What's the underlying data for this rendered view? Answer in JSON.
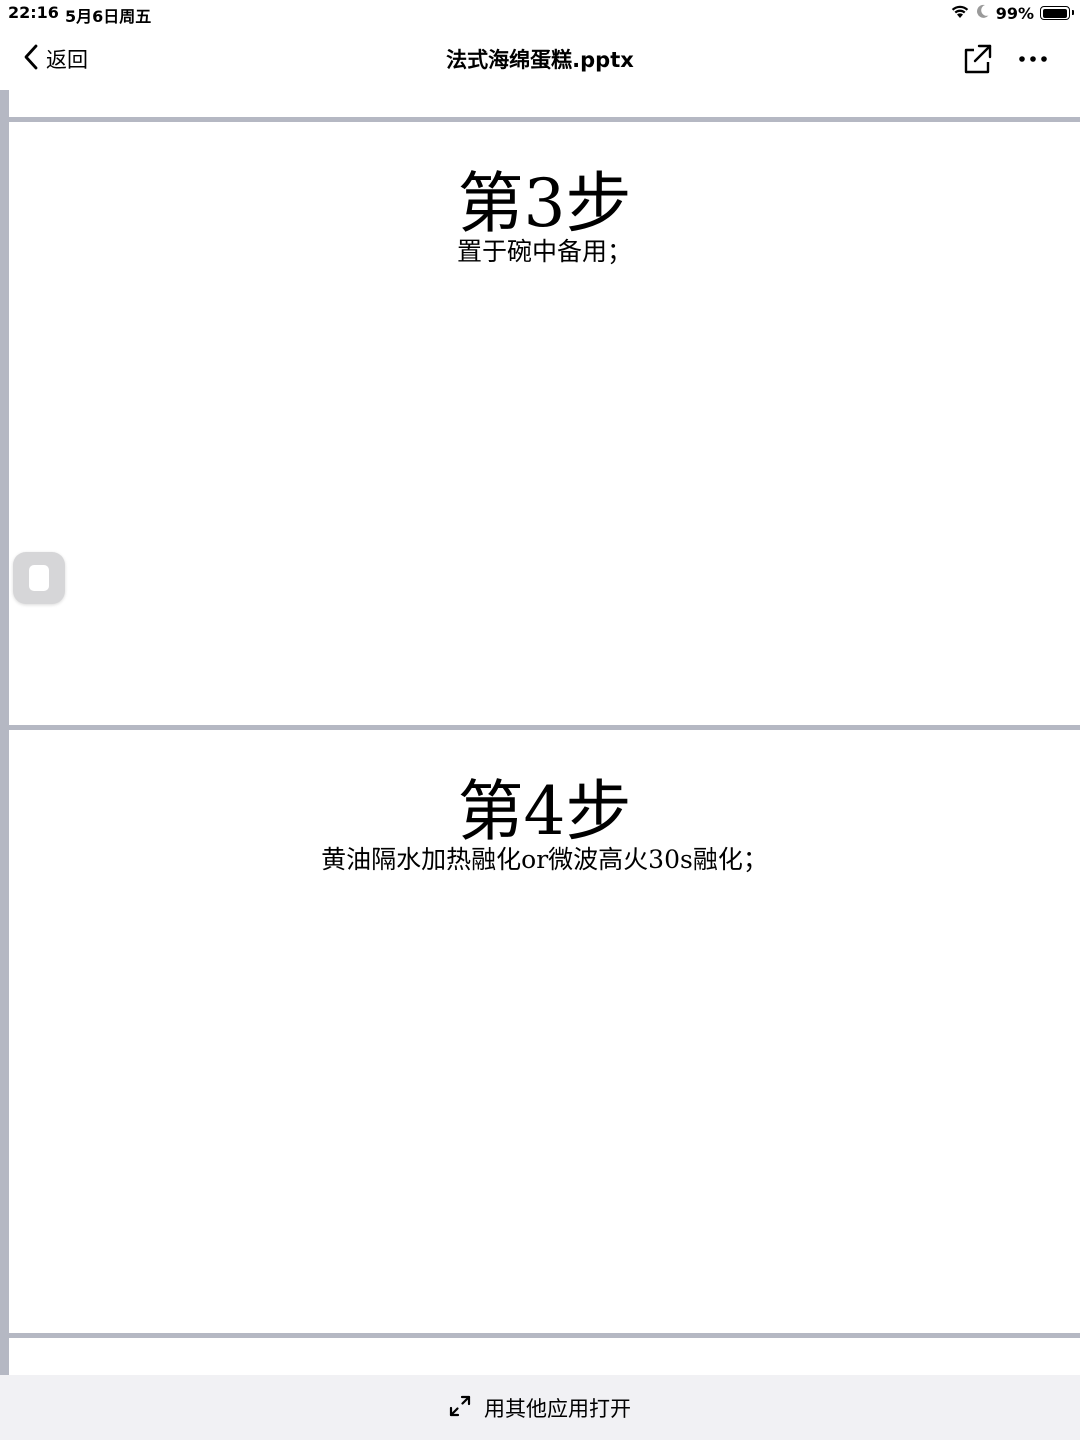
{
  "status_bar": {
    "time": "22:16",
    "date": "5月6日周五",
    "battery_percent": "99%",
    "battery_level": 0.99,
    "icons": [
      "wifi-icon",
      "moon-icon",
      "battery-icon"
    ]
  },
  "nav": {
    "back_label": "返回",
    "title": "法式海绵蛋糕.pptx",
    "share_icon": "share-icon",
    "more_icon": "more-icon"
  },
  "slides": [
    {
      "heading": "第3步",
      "body": "置于碗中备用；"
    },
    {
      "heading": "第4步",
      "body": "黄油隔水加热融化or微波高火30s融化；"
    }
  ],
  "bottom": {
    "open_with_label": "用其他应用打开",
    "icon": "expand-icon"
  },
  "colors": {
    "separator": "#b5b8c3",
    "bottom_bar": "#f1f1f4",
    "handle": "#d6d6d8"
  }
}
